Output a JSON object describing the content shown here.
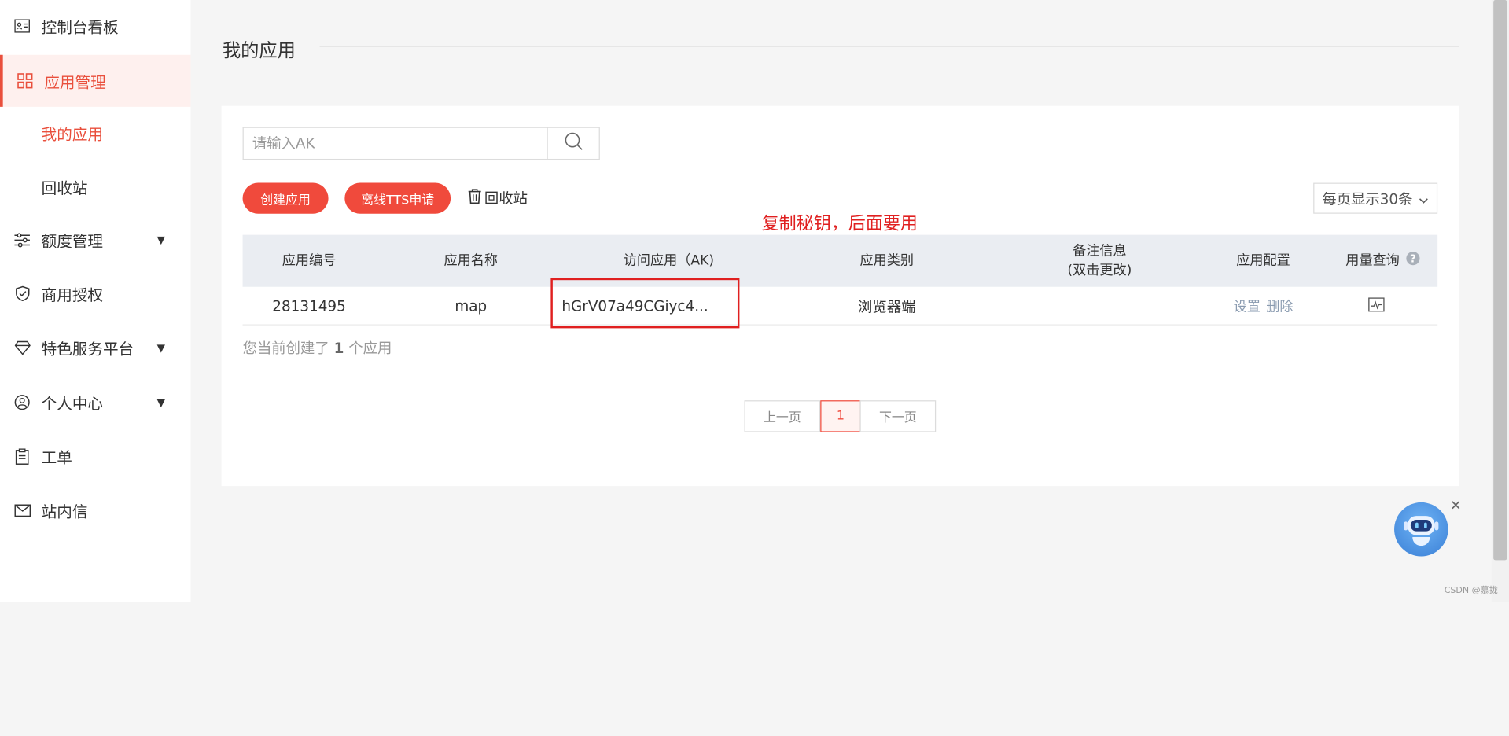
{
  "sidebar": {
    "items": [
      {
        "label": "控制台看板",
        "icon": "dashboard-card-icon"
      },
      {
        "label": "应用管理",
        "icon": "app-grid-icon"
      },
      {
        "label": "我的应用"
      },
      {
        "label": "回收站"
      },
      {
        "label": "额度管理",
        "icon": "quota-sliders-icon"
      },
      {
        "label": "商用授权",
        "icon": "shield-check-icon"
      },
      {
        "label": "特色服务平台",
        "icon": "diamond-icon"
      },
      {
        "label": "个人中心",
        "icon": "user-circle-icon"
      },
      {
        "label": "工单",
        "icon": "clipboard-icon"
      },
      {
        "label": "站内信",
        "icon": "mail-icon"
      }
    ]
  },
  "main": {
    "title": "我的应用",
    "search_placeholder": "请输入AK",
    "create_button": "创建应用",
    "offline_tts_button": "离线TTS申请",
    "recycle_link": "回收站",
    "page_size": "每页显示30条",
    "annotation": "复制秘钥，后面要用",
    "columns": {
      "id": "应用编号",
      "name": "应用名称",
      "ak": "访问应用（AK)",
      "type": "应用类别",
      "remark_line1": "备注信息",
      "remark_line2": "(双击更改)",
      "config": "应用配置",
      "usage": "用量查询"
    },
    "row": {
      "id": "28131495",
      "name": "map",
      "ak": "hGrV07a49CGiyc4...",
      "type": "浏览器端",
      "settings": "设置",
      "delete": "删除"
    },
    "count_prefix": "您当前创建了",
    "count_value": "1",
    "count_suffix": "个应用",
    "pagination": {
      "prev": "上一页",
      "current": "1",
      "next": "下一页"
    }
  },
  "footer": {
    "watermark": "CSDN @慕拢"
  },
  "colors": {
    "accent": "#f04a3c",
    "annotation": "#e02020"
  }
}
